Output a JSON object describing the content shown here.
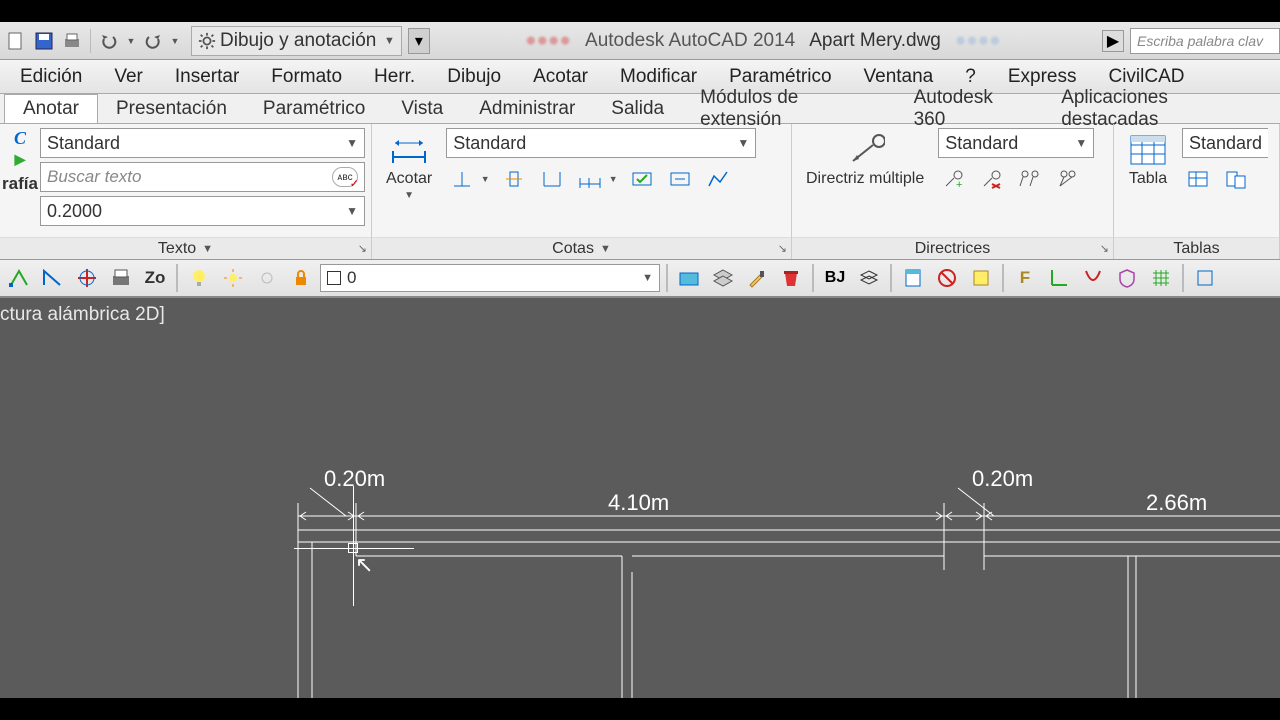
{
  "title": {
    "product": "Autodesk AutoCAD 2014",
    "file": "Apart Mery.dwg"
  },
  "workspace": {
    "label": "Dibujo y anotación"
  },
  "search": {
    "placeholder": "Escriba palabra clav"
  },
  "menu": [
    "Edición",
    "Ver",
    "Insertar",
    "Formato",
    "Herr.",
    "Dibujo",
    "Acotar",
    "Modificar",
    "Paramétrico",
    "Ventana",
    "?",
    "Express",
    "CivilCAD"
  ],
  "ribbon_tabs": [
    "Anotar",
    "Presentación",
    "Paramétrico",
    "Vista",
    "Administrar",
    "Salida",
    "Módulos de extensión",
    "Autodesk 360",
    "Aplicaciones destacadas"
  ],
  "active_tab": "Anotar",
  "panels": {
    "texto": {
      "title": "Texto",
      "style": "Standard",
      "search_ph": "Buscar texto",
      "height": "0.2000",
      "side_label": "rafía"
    },
    "cotas": {
      "title": "Cotas",
      "big": "Acotar",
      "style": "Standard"
    },
    "directrices": {
      "title": "Directrices",
      "big": "Directriz múltiple",
      "style": "Standard"
    },
    "tablas": {
      "title": "Tablas",
      "big": "Tabla",
      "style": "Standard"
    }
  },
  "layer": {
    "name": "0"
  },
  "viewport_label": "ctura alámbrica 2D]",
  "dims": {
    "d1": "0.20m",
    "d2": "4.10m",
    "d3": "0.20m",
    "d4": "2.66m"
  }
}
